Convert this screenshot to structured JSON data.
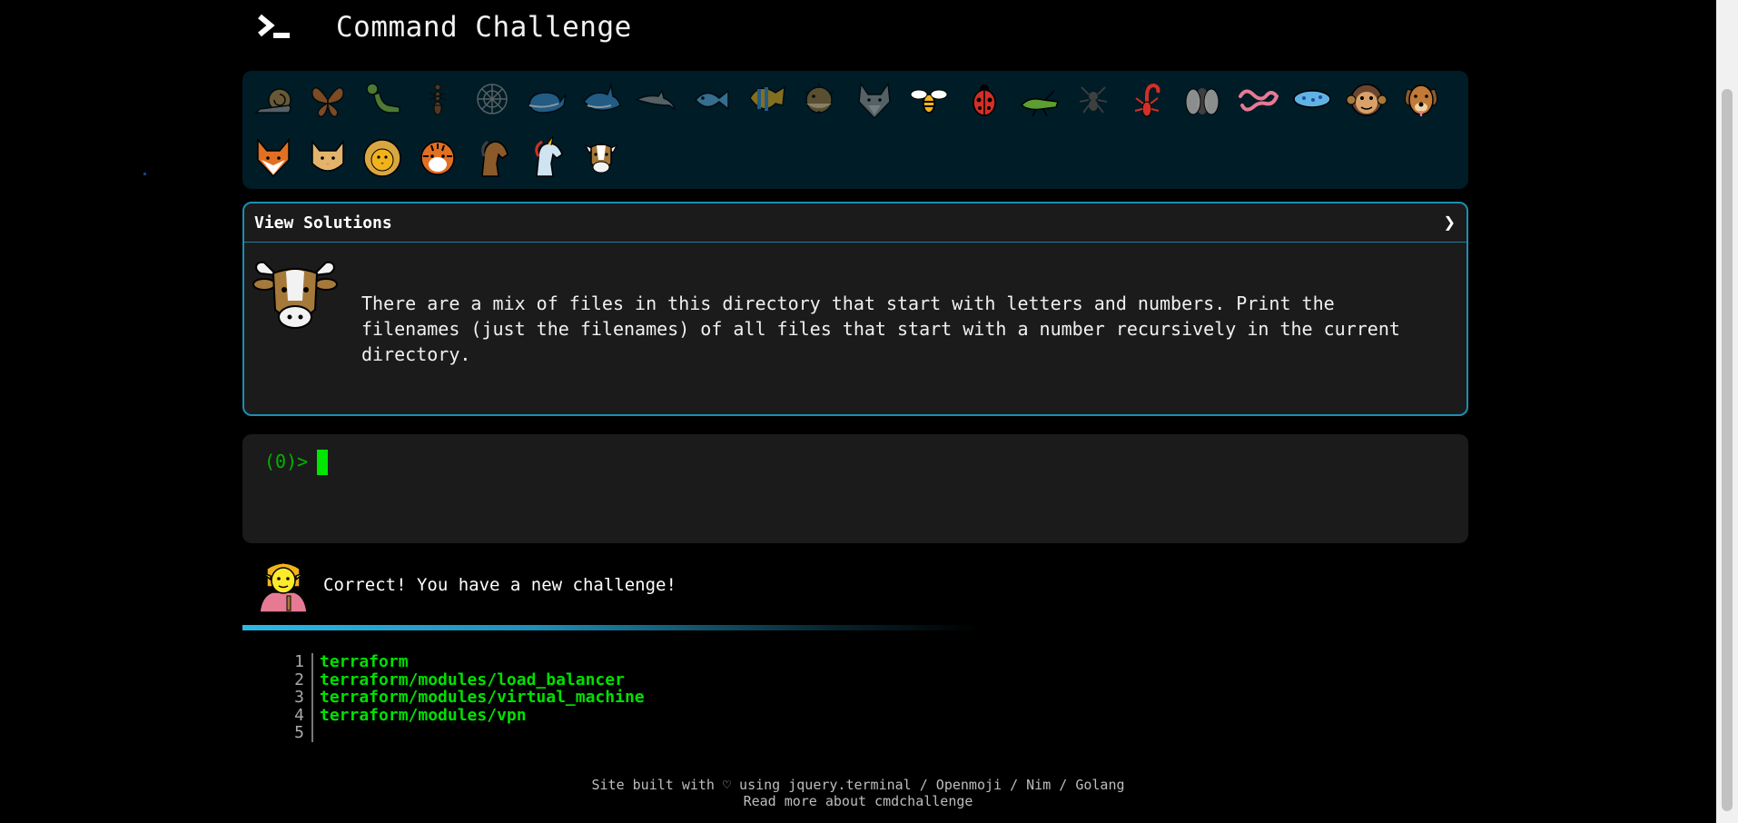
{
  "header": {
    "title": "Command Challenge",
    "logo_icon": "terminal-prompt-icon"
  },
  "levels": [
    {
      "icon": "snail-icon",
      "color": "#c08a3e"
    },
    {
      "icon": "butterfly-icon",
      "color": "#e27022"
    },
    {
      "icon": "caterpillar-icon",
      "color": "#8cc63e"
    },
    {
      "icon": "ant-icon",
      "color": "#9b4e1c"
    },
    {
      "icon": "spider-web-icon",
      "color": "#9b9b9a"
    },
    {
      "icon": "whale-icon",
      "color": "#3f8fcf"
    },
    {
      "icon": "shark-icon",
      "color": "#3f8fcf"
    },
    {
      "icon": "dolphin-icon",
      "color": "#9b9b9a"
    },
    {
      "icon": "fish-icon",
      "color": "#61b2e4"
    },
    {
      "icon": "tropical-fish-icon",
      "color": "#f1b31c"
    },
    {
      "icon": "blowfish-icon",
      "color": "#a57939"
    },
    {
      "icon": "wolf-icon",
      "color": "#9b9b9a"
    },
    {
      "icon": "bee-icon",
      "color": "#f1b31c"
    },
    {
      "icon": "ladybug-icon",
      "color": "#d22f27"
    },
    {
      "icon": "cricket-icon",
      "color": "#5c9e31"
    },
    {
      "icon": "spider-icon",
      "color": "#3f3f3f"
    },
    {
      "icon": "scorpion-icon",
      "color": "#d22f27"
    },
    {
      "icon": "fly-icon",
      "color": "#9b9b9a"
    },
    {
      "icon": "worm-icon",
      "color": "#e67a94"
    },
    {
      "icon": "microbe-icon",
      "color": "#61b2e4"
    },
    {
      "icon": "monkey-icon",
      "color": "#6a462f"
    },
    {
      "icon": "dog-icon",
      "color": "#c17a37"
    },
    {
      "icon": "fox-icon",
      "color": "#e27022"
    },
    {
      "icon": "cat-icon",
      "color": "#e2b46b"
    },
    {
      "icon": "lion-icon",
      "color": "#d9a741"
    },
    {
      "icon": "tiger-icon",
      "color": "#e27022"
    },
    {
      "icon": "horse-icon",
      "color": "#8a5a2b"
    },
    {
      "icon": "unicorn-icon",
      "color": "#cfe3f1"
    },
    {
      "icon": "cow-icon",
      "color": "#ffffff"
    }
  ],
  "card": {
    "title": "View Solutions",
    "chevron": "❯",
    "challenge_icon": "cow-face-icon",
    "description": "There are a mix of files in this directory that start with letters and numbers. Print the filenames (just the filenames) of all files that start with a number recursively in the current directory."
  },
  "terminal": {
    "prompt": "(0)>"
  },
  "status": {
    "avatar_icon": "elf-icon",
    "message": "Correct! You have a new challenge!"
  },
  "output": {
    "lines": [
      {
        "num": "1",
        "text": "terraform"
      },
      {
        "num": "2",
        "text": "terraform/modules/load_balancer"
      },
      {
        "num": "3",
        "text": "terraform/modules/virtual_machine"
      },
      {
        "num": "4",
        "text": "terraform/modules/vpn"
      },
      {
        "num": "5",
        "text": ""
      }
    ]
  },
  "footer": {
    "line1": "Site built with ♡ using jquery.terminal / Openmoji / Nim / Golang",
    "line2": "Read more about cmdchallenge"
  },
  "colors": {
    "accent": "#1a8fb3",
    "prompt_green": "#00b400",
    "output_green": "#00e000",
    "level_bg": "#001c26"
  }
}
